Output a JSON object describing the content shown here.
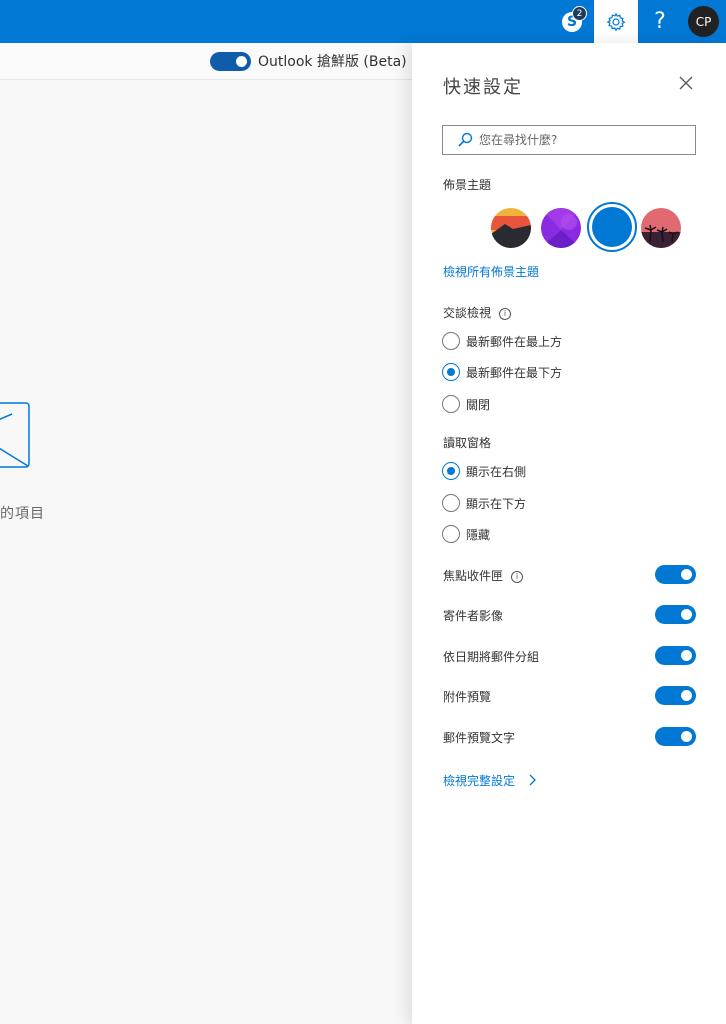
{
  "topbar": {
    "skype_badge": "2",
    "avatar_initials": "CP",
    "help_glyph": "?",
    "brand_color": "#0078d4"
  },
  "mail": {
    "beta_label": "Outlook 搶鮮版 (Beta)",
    "beta_enabled": true,
    "empty_text": "的項目"
  },
  "quick_settings": {
    "title": "快速設定",
    "search_placeholder": "您在尋找什麼?",
    "theme_heading": "佈景主題",
    "themes": [
      "sunset-mountain",
      "purple",
      "blue",
      "palm-sunset"
    ],
    "selected_theme": "blue",
    "view_all_themes": "檢視所有佈景主題",
    "conversation": {
      "heading": "交談檢視",
      "options": [
        "最新郵件在最上方",
        "最新郵件在最下方",
        "關閉"
      ],
      "selected": "最新郵件在最下方"
    },
    "reading_pane": {
      "heading": "讀取窗格",
      "options": [
        "顯示在右側",
        "顯示在下方",
        "隱藏"
      ],
      "selected": "顯示在右側"
    },
    "toggles": [
      {
        "label": "焦點收件匣",
        "on": true
      },
      {
        "label": "寄件者影像",
        "on": true
      },
      {
        "label": "依日期將郵件分組",
        "on": true
      },
      {
        "label": "附件預覽",
        "on": true
      },
      {
        "label": "郵件預覽文字",
        "on": true
      }
    ],
    "view_full_settings": "檢視完整設定"
  }
}
